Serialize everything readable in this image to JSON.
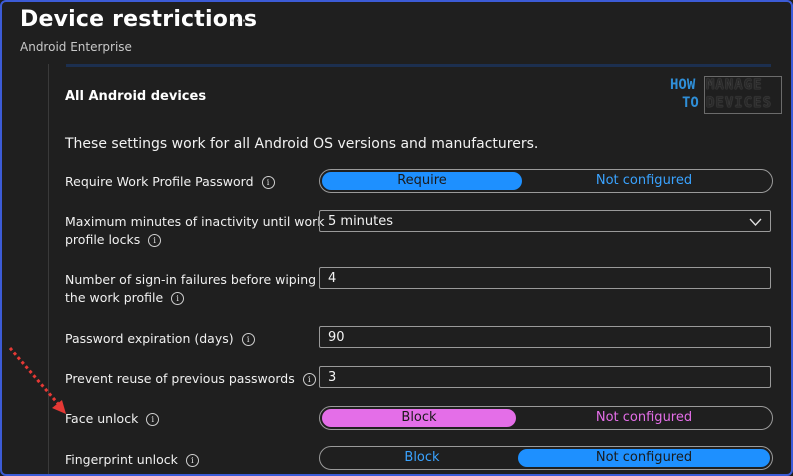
{
  "header": {
    "title": "Device restrictions",
    "subtitle": "Android Enterprise",
    "more": "···"
  },
  "section": {
    "title": "All Android devices",
    "intro": "These settings work for all Android OS versions and manufacturers."
  },
  "logo": {
    "how": "HOW",
    "to": "TO",
    "manage": "MANAGE",
    "devices": "DEVICES"
  },
  "settings": {
    "work_profile_password": {
      "label": "Require Work Profile Password",
      "left": "Require",
      "right": "Not configured",
      "selected": "left",
      "color": "#1e90ff"
    },
    "inactivity": {
      "label_line1": "Maximum minutes of inactivity until work",
      "label_line2": "profile locks",
      "value": "5 minutes"
    },
    "signin_failures": {
      "label_line1": "Number of sign-in failures before wiping",
      "label_line2": "the work profile",
      "value": "4"
    },
    "password_expiration": {
      "label": "Password expiration (days)",
      "value": "90"
    },
    "prevent_reuse": {
      "label": "Prevent reuse of previous passwords",
      "value": "3"
    },
    "face_unlock": {
      "label": "Face unlock",
      "left": "Block",
      "right": "Not configured",
      "selected": "left",
      "color": "#e46ee8"
    },
    "fingerprint_unlock": {
      "label": "Fingerprint unlock",
      "left": "Block",
      "right": "Not configured",
      "selected": "right",
      "color": "#1e90ff"
    }
  },
  "colors": {
    "blue_accent": "#1e90ff",
    "magenta_accent": "#e46ee8",
    "frame_border": "#3c5bd6",
    "annotation_red": "#e53935"
  }
}
